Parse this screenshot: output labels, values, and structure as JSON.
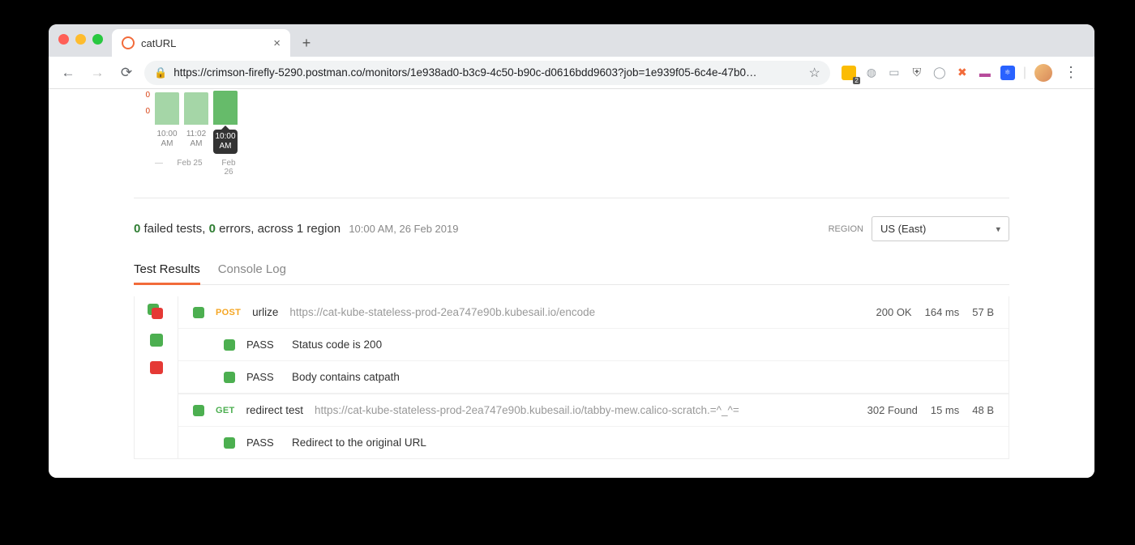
{
  "browser": {
    "tab_title": "catURL",
    "url_display": "https://crimson-firefly-5290.postman.co/monitors/1e938ad0-b3c9-4c50-b90c-d0616bdd9603?job=1e939f05-6c4e-47b0…",
    "ext_badge": "2"
  },
  "chart_data": {
    "type": "bar",
    "categories": [
      "10:00 AM",
      "11:02 AM",
      "10:00 AM"
    ],
    "values": [
      1,
      1,
      1
    ],
    "selected_index": 2,
    "ytick_labels": [
      "0",
      "0"
    ],
    "date_groups": [
      "Feb 25",
      "Feb 26"
    ],
    "xlabel": "",
    "ylabel": "",
    "title": ""
  },
  "summary": {
    "failed_count": "0",
    "failed_label": " failed tests, ",
    "errors_count": "0",
    "errors_label": " errors, across 1 region",
    "timestamp": "10:00 AM, 26 Feb 2019"
  },
  "region": {
    "label": "REGION",
    "selected": "US (East)"
  },
  "tabs": [
    {
      "label": "Test Results",
      "active": true
    },
    {
      "label": "Console Log",
      "active": false
    }
  ],
  "requests": [
    {
      "method": "POST",
      "name": "urlize",
      "url": "https://cat-kube-stateless-prod-2ea747e90b.kubesail.io/encode",
      "status": "200 OK",
      "time": "164 ms",
      "size": "57 B",
      "tests": [
        {
          "result": "PASS",
          "desc": "Status code is 200"
        },
        {
          "result": "PASS",
          "desc": "Body contains catpath"
        }
      ]
    },
    {
      "method": "GET",
      "name": "redirect test",
      "url": "https://cat-kube-stateless-prod-2ea747e90b.kubesail.io/tabby-mew.calico-scratch.=^_^=",
      "status": "302 Found",
      "time": "15 ms",
      "size": "48 B",
      "tests": [
        {
          "result": "PASS",
          "desc": "Redirect to the original URL"
        }
      ]
    }
  ]
}
